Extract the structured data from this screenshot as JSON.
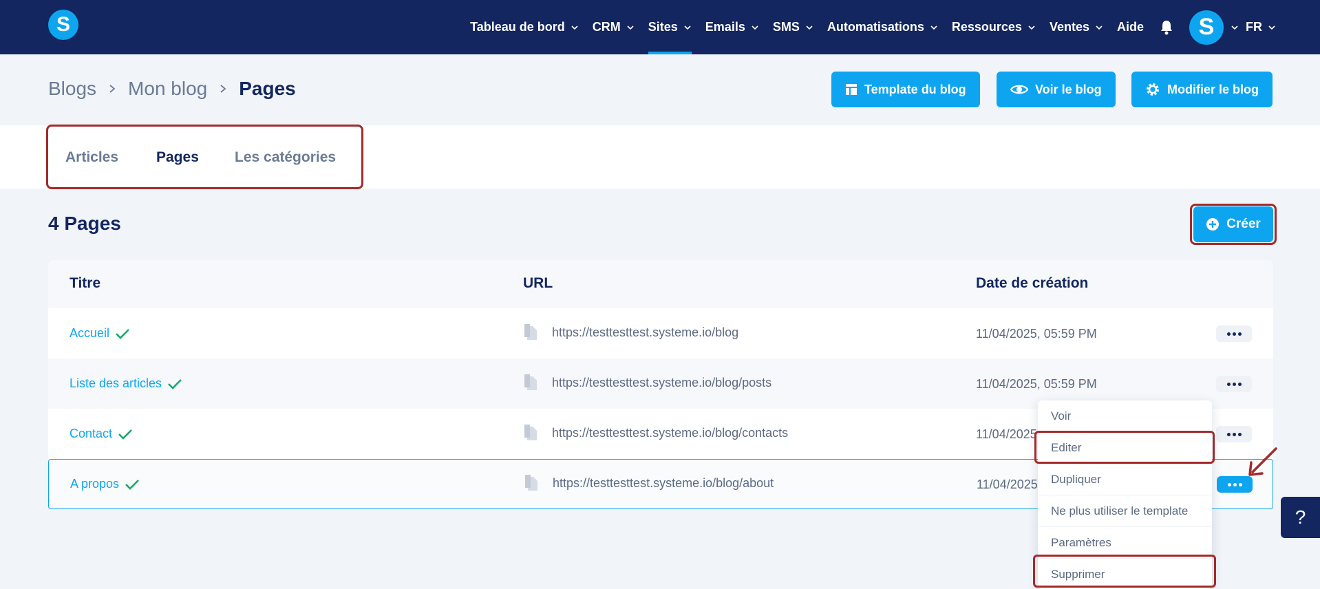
{
  "nav": {
    "logo": "S",
    "items": [
      {
        "label": "Tableau de bord",
        "chevron": true
      },
      {
        "label": "CRM",
        "chevron": true
      },
      {
        "label": "Sites",
        "chevron": true,
        "active": true
      },
      {
        "label": "Emails",
        "chevron": true
      },
      {
        "label": "SMS",
        "chevron": true
      },
      {
        "label": "Automatisations",
        "chevron": true
      },
      {
        "label": "Ressources",
        "chevron": true
      },
      {
        "label": "Ventes",
        "chevron": true
      },
      {
        "label": "Aide",
        "chevron": false
      }
    ],
    "avatar": "S",
    "language": "FR"
  },
  "breadcrumb": [
    "Blogs",
    "Mon blog",
    "Pages"
  ],
  "actions": {
    "template": "Template du blog",
    "view": "Voir le blog",
    "edit": "Modifier le blog"
  },
  "tabs": [
    "Articles",
    "Pages",
    "Les catégories"
  ],
  "section_title": "4 Pages",
  "create_label": "Créer",
  "table": {
    "headers": [
      "Titre",
      "URL",
      "Date de création"
    ],
    "rows": [
      {
        "title": "Accueil",
        "url": "https://testtesttest.systeme.io/blog",
        "date": "11/04/2025, 05:59 PM"
      },
      {
        "title": "Liste des articles",
        "url": "https://testtesttest.systeme.io/blog/posts",
        "date": "11/04/2025, 05:59 PM"
      },
      {
        "title": "Contact",
        "url": "https://testtesttest.systeme.io/blog/contacts",
        "date": "11/04/2025,"
      },
      {
        "title": "A propos",
        "url": "https://testtesttest.systeme.io/blog/about",
        "date": "11/04/2025,"
      }
    ]
  },
  "dropdown": [
    "Voir",
    "Editer",
    "Dupliquer",
    "Ne plus utiliser le template",
    "Paramètres",
    "Supprimer"
  ],
  "help_label": "?",
  "colors": {
    "navy": "#13265f",
    "accent": "#0ea5f0",
    "highlight": "#a32a2a",
    "check": "#1aa86b"
  }
}
